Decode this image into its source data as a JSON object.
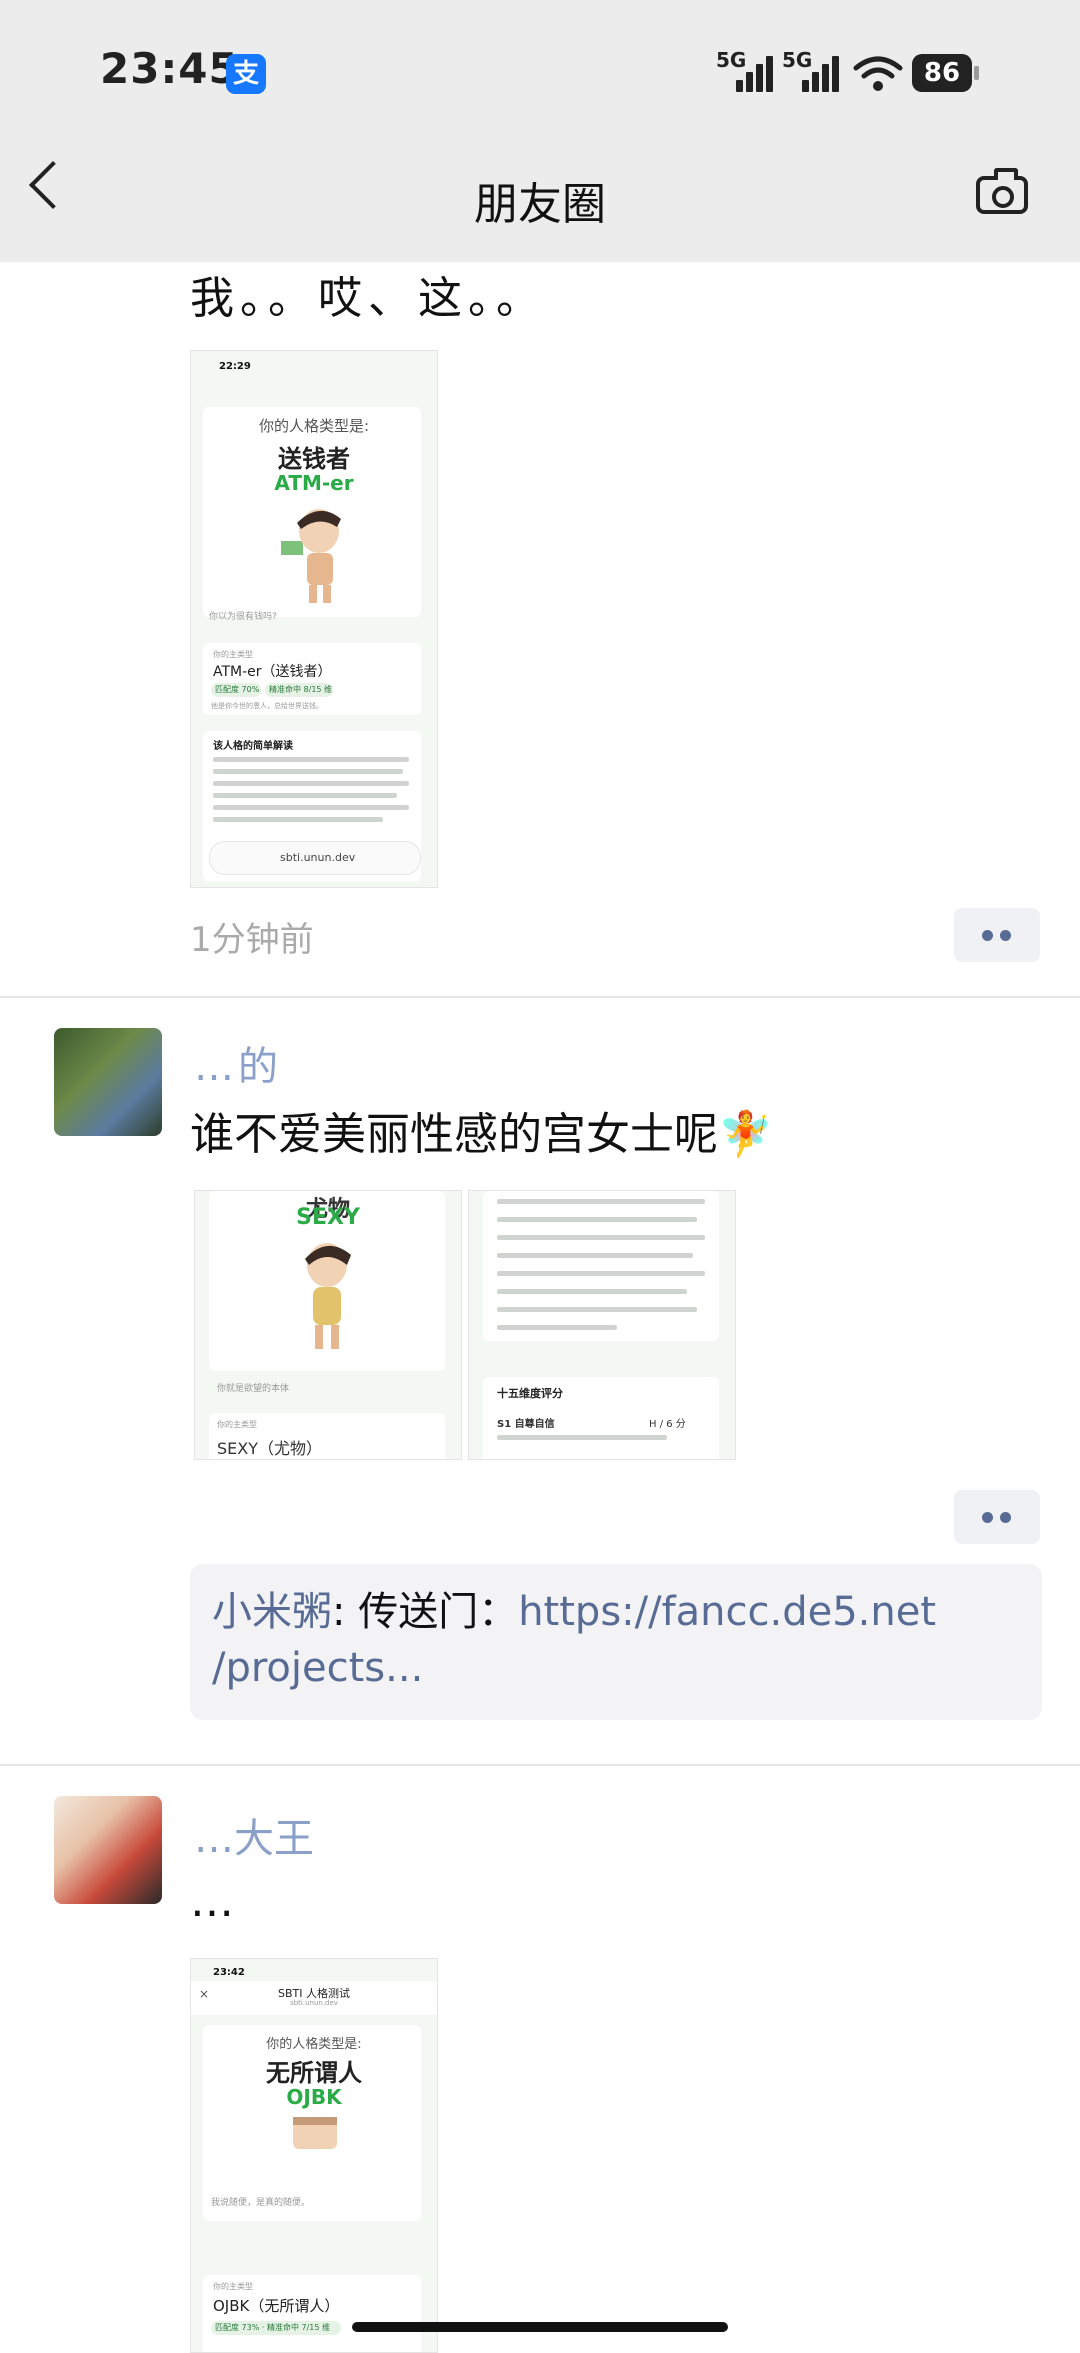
{
  "status_bar": {
    "time": "23:45",
    "app_badge": "支",
    "signal_1": "5G",
    "signal_2": "5G",
    "battery": "86"
  },
  "nav": {
    "title": "朋友圈"
  },
  "post1": {
    "content": "我。。哎、这。。",
    "time_ago": "1分钟前",
    "shot": {
      "status_time": "22:29",
      "type_label": "你的人格类型是:",
      "type_name": "送钱者",
      "type_code": "ATM-er",
      "img_note": "你以为很有钱吗?",
      "main_type_label": "你的主类型",
      "main_type": "ATM-er（送钱者）",
      "match": "匹配度 70%",
      "hit": "精准命中 8/15 维",
      "summary_line": "他是你今世的恩人，总给世界送钱。",
      "section_title": "该人格的简单解读",
      "url": "sbti.unun.dev"
    }
  },
  "post2": {
    "name": "…的",
    "content": "谁不爱美丽性感的宫女士呢🧚",
    "time_ago": "",
    "shot_left": {
      "type_name": "尤物",
      "type_code": "SEXY",
      "img_note": "你就是欲望的本体",
      "main_type_label": "你的主类型",
      "main_type": "SEXY（尤物）"
    },
    "shot_right": {
      "section_title": "十五维度评分",
      "row_label": "S1 自尊自信",
      "row_value": "H / 6 分"
    },
    "comment": {
      "author": "小米粥",
      "sep": ": ",
      "text": "传送门：",
      "link_line1": "https://fancc.de5.net",
      "link_line2": "/projects..."
    }
  },
  "post3": {
    "name": "…大王",
    "content": "…",
    "shot": {
      "status_time": "23:42",
      "page_title": "SBTI 人格测试",
      "page_url": "sbti.unun.dev",
      "type_label": "你的人格类型是:",
      "type_name": "无所谓人",
      "type_code": "OJBK",
      "img_note": "我说随便，是真的随便。",
      "main_type_label": "你的主类型",
      "main_type": "OJBK（无所谓人）",
      "match": "匹配度 73% · 精准命中 7/15 维"
    }
  },
  "colors": {
    "link": "#576b95",
    "accent_green": "#2bab47",
    "nav_bg": "#ececec"
  }
}
